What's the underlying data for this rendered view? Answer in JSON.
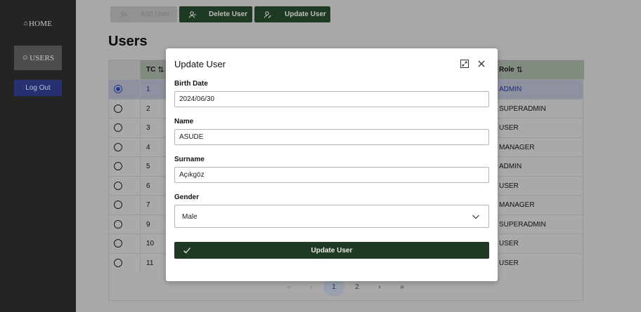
{
  "sidebar": {
    "home_label": "HOME",
    "users_label": "USERS",
    "logout_label": "Log Out"
  },
  "toolbar": {
    "add_label": "Add User",
    "delete_label": "Delete User",
    "update_label": "Update User"
  },
  "page": {
    "title": "Users"
  },
  "table": {
    "col_tc": "TC",
    "col_role": "Role",
    "sort_glyph": "⇅",
    "rows": [
      {
        "tc": "1",
        "role": "ADMIN",
        "selected": true
      },
      {
        "tc": "2",
        "role": "SUPERADMIN"
      },
      {
        "tc": "3",
        "role": "USER"
      },
      {
        "tc": "4",
        "role": "MANAGER"
      },
      {
        "tc": "5",
        "role": "ADMIN"
      },
      {
        "tc": "6",
        "role": "USER"
      },
      {
        "tc": "7",
        "role": "MANAGER"
      },
      {
        "tc": "9",
        "role": "SUPERADMIN"
      },
      {
        "tc": "10",
        "role": "USER"
      },
      {
        "tc": "11",
        "role": "USER"
      }
    ]
  },
  "pager": {
    "first": "«",
    "prev": "‹",
    "page1": "1",
    "page2": "2",
    "next": "›",
    "last": "»",
    "current_page": 1
  },
  "modal": {
    "title": "Update User",
    "birth_label": "Birth Date",
    "birth_value": "2024/06/30",
    "name_label": "Name",
    "name_value": "ASUDE",
    "surname_label": "Surname",
    "surname_value": "Açıkgöz",
    "gender_label": "Gender",
    "gender_value": "Male",
    "submit_label": "Update User"
  },
  "colors": {
    "accent_green": "#1e3a22",
    "accent_blue": "#253170",
    "sidebar_bg": "#242424"
  }
}
